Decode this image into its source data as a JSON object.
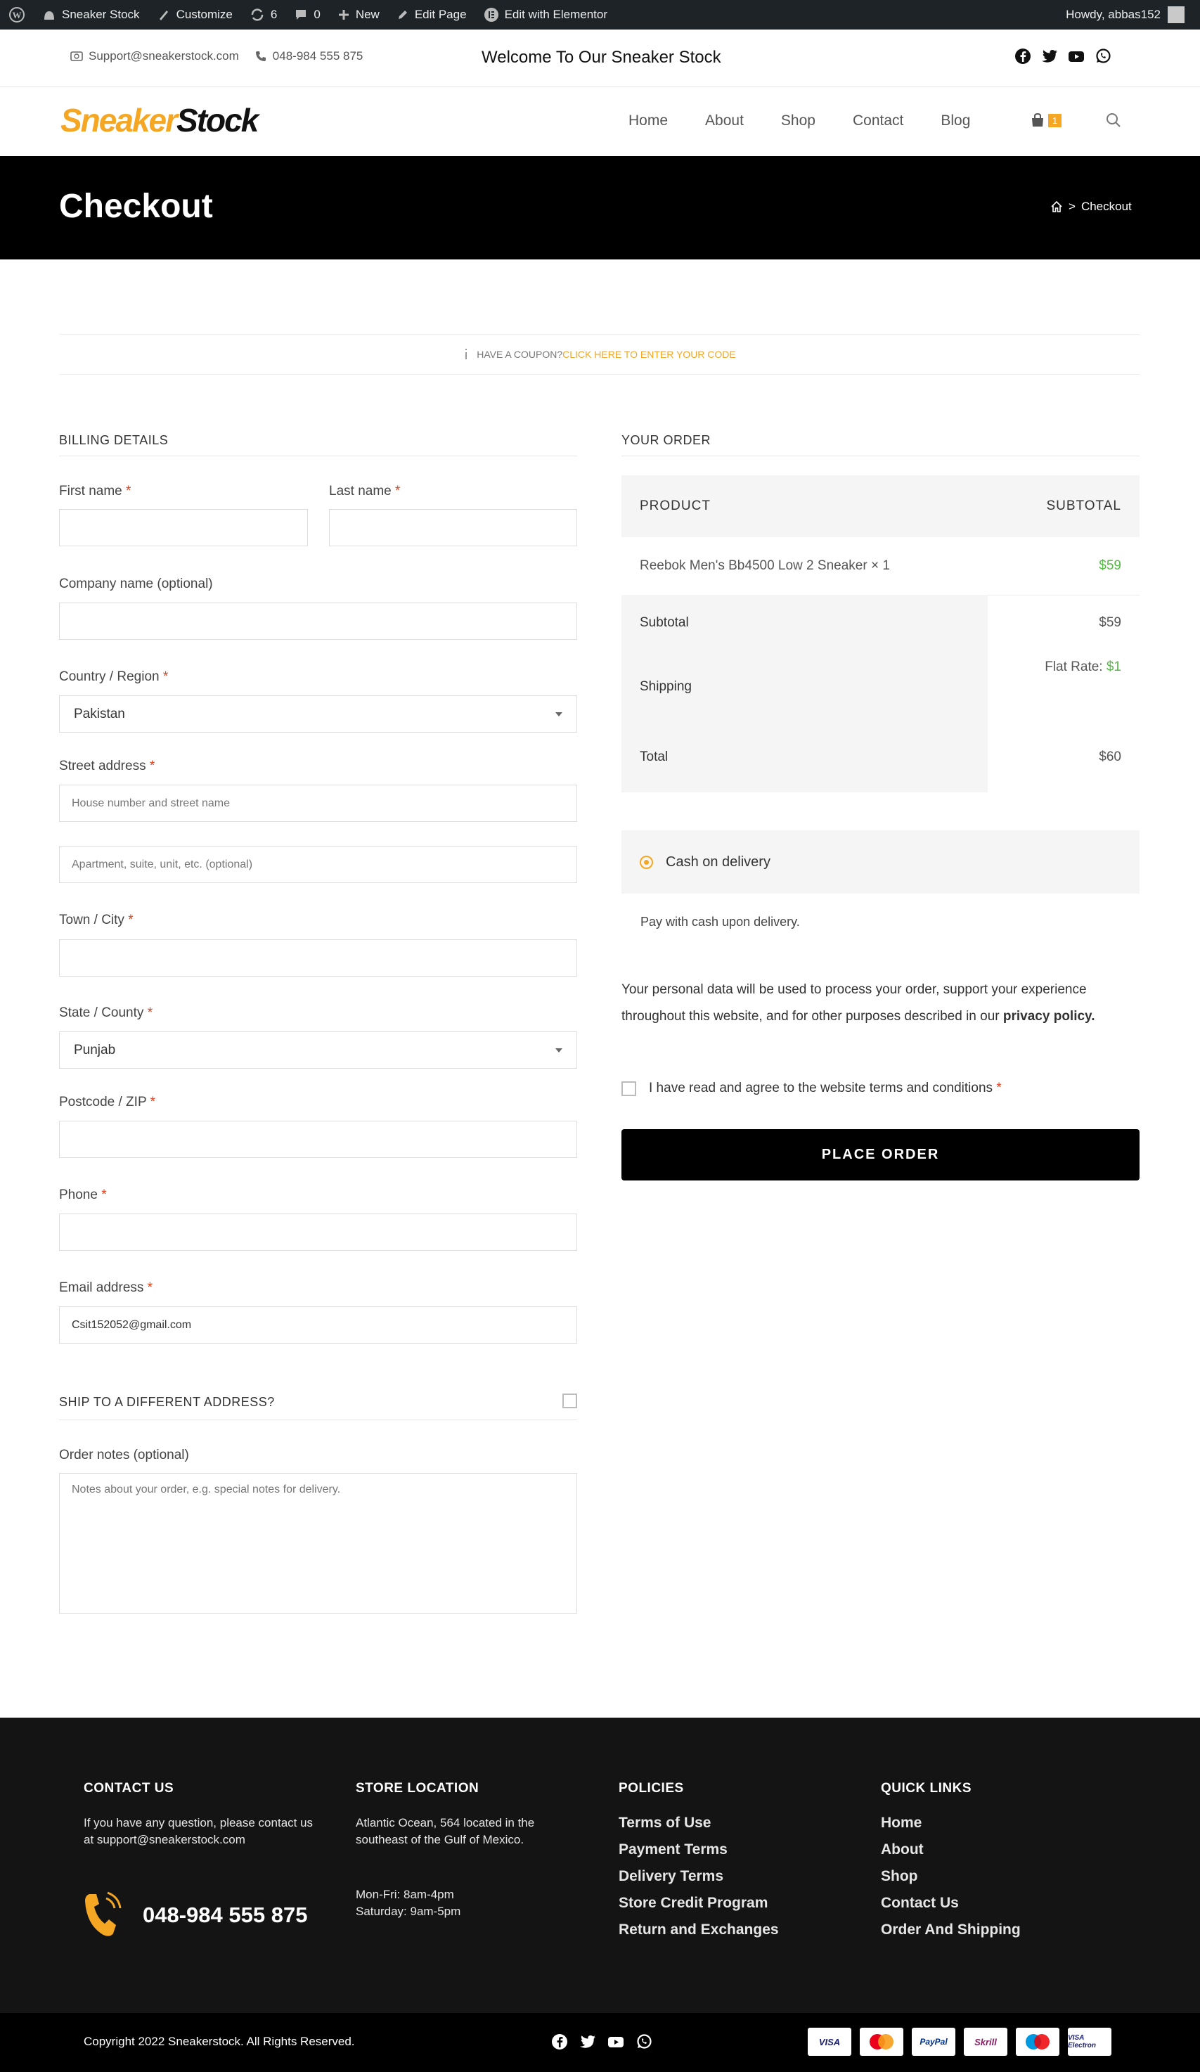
{
  "admin_bar": {
    "site": "Sneaker Stock",
    "customize": "Customize",
    "updates": "6",
    "comments": "0",
    "new": "New",
    "edit_page": "Edit Page",
    "elementor": "Edit with Elementor",
    "howdy": "Howdy, abbas152"
  },
  "topbar": {
    "email": "Support@sneakerstock.com",
    "phone": "048-984 555 875",
    "welcome": "Welcome To Our Sneaker Stock",
    "social_icons": [
      "facebook-icon",
      "twitter-icon",
      "youtube-icon",
      "whatsapp-icon"
    ]
  },
  "header": {
    "logo_part1": "Sneaker",
    "logo_part2": "Stock",
    "nav": [
      "Home",
      "About",
      "Shop",
      "Contact",
      "Blog"
    ],
    "cart_count": "1"
  },
  "page": {
    "title": "Checkout",
    "breadcrumb_current": "Checkout"
  },
  "coupon": {
    "prompt": "HAVE A COUPON?",
    "link": "CLICK HERE TO ENTER YOUR CODE"
  },
  "billing": {
    "title": "BILLING DETAILS",
    "first_name_label": "First name",
    "last_name_label": "Last name",
    "company_label": "Company name (optional)",
    "country_label": "Country / Region",
    "country_value": "Pakistan",
    "street_label": "Street address",
    "street_placeholder": "House number and street name",
    "apt_placeholder": "Apartment, suite, unit, etc. (optional)",
    "city_label": "Town / City",
    "state_label": "State / County",
    "state_value": "Punjab",
    "postcode_label": "Postcode / ZIP",
    "phone_label": "Phone",
    "email_label": "Email address",
    "email_value": "Csit152052@gmail.com",
    "ship_different": "SHIP TO A DIFFERENT ADDRESS?",
    "notes_label": "Order notes (optional)",
    "notes_placeholder": "Notes about your order, e.g. special notes for delivery.",
    "required_mark": "*"
  },
  "order": {
    "title": "YOUR ORDER",
    "col_product": "PRODUCT",
    "col_subtotal": "SUBTOTAL",
    "item_name": "Reebok Men's Bb4500 Low 2 Sneaker",
    "item_qty": "× 1",
    "item_price": "$59",
    "subtotal_label": "Subtotal",
    "subtotal_value": "$59",
    "shipping_label": "Shipping",
    "shipping_method": "Flat Rate:",
    "shipping_value": "$1",
    "total_label": "Total",
    "total_value": "$60",
    "payment_method": "Cash on delivery",
    "payment_desc": "Pay with cash upon delivery.",
    "privacy_text": "Your personal data will be used to process your order, support your experience throughout this website, and for other purposes described in our",
    "privacy_link": "privacy policy.",
    "terms_text": "I have read and agree to the website terms and conditions",
    "terms_mark": "*",
    "place_order": "PLACE ORDER"
  },
  "footer": {
    "contact_title": "CONTACT US",
    "contact_text": "If you have any question, please contact us at support@sneakerstock.com",
    "phone": "048-984 555 875",
    "location_title": "STORE LOCATION",
    "location_text": "Atlantic Ocean, 564 located in the southeast of the Gulf of Mexico.",
    "hours_1": "Mon-Fri: 8am-4pm",
    "hours_2": "Saturday: 9am-5pm",
    "policies_title": "POLICIES",
    "policies": [
      "Terms of Use",
      "Payment Terms",
      "Delivery Terms",
      "Store Credit Program",
      "Return and Exchanges"
    ],
    "links_title": "QUICK LINKS",
    "links": [
      "Home",
      "About",
      "Shop",
      "Contact Us",
      "Order And Shipping"
    ],
    "copyright": "Copyright 2022 Sneakerstock. All Rights Reserved.",
    "cards": [
      "VISA",
      "Mastercard",
      "PayPal",
      "Skrill",
      "Maestro",
      "VISA Electron"
    ]
  },
  "colors": {
    "accent": "#f5a623",
    "price_green": "#57b846",
    "dark": "#000000"
  }
}
